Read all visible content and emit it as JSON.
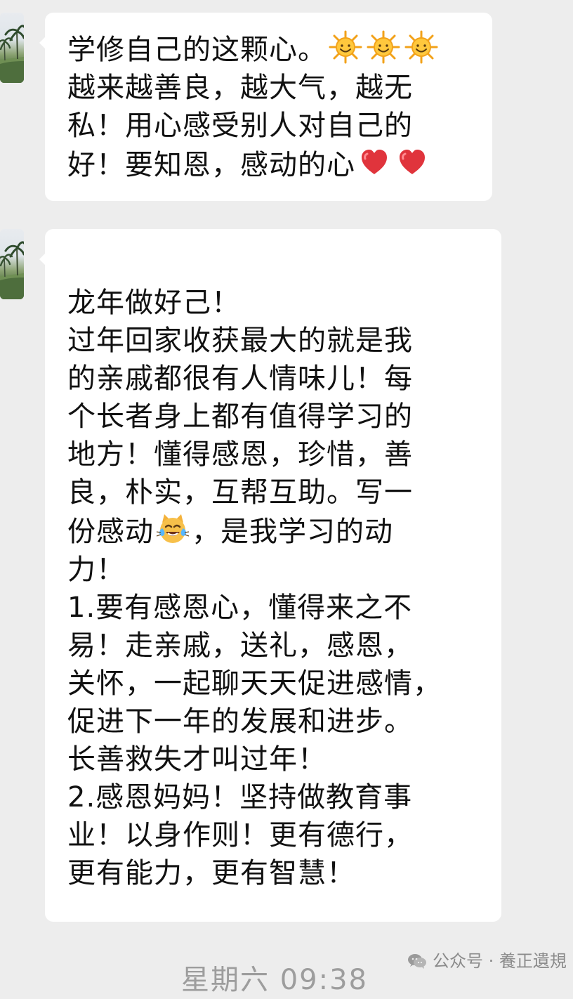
{
  "messages": [
    {
      "lines": [
        {
          "parts": [
            {
              "t": "text",
              "v": "学修自己的这颗心。"
            },
            {
              "t": "icon",
              "v": "sun-emoji"
            },
            {
              "t": "icon",
              "v": "sun-emoji"
            },
            {
              "t": "icon",
              "v": "sun-emoji"
            }
          ]
        },
        {
          "parts": [
            {
              "t": "text",
              "v": "越来越善良，越大气，越无"
            }
          ]
        },
        {
          "parts": [
            {
              "t": "text",
              "v": "私！用心感受别人对自己的"
            }
          ]
        },
        {
          "parts": [
            {
              "t": "text",
              "v": "好！要知恩，感动的心"
            },
            {
              "t": "icon",
              "v": "heart-emoji"
            },
            {
              "t": "icon",
              "v": "heart-emoji"
            }
          ]
        }
      ]
    },
    {
      "lines": [
        {
          "parts": [
            {
              "t": "text",
              "v": "龙年做好己！"
            }
          ]
        },
        {
          "parts": [
            {
              "t": "text",
              "v": "过年回家收获最大的就是我"
            }
          ]
        },
        {
          "parts": [
            {
              "t": "text",
              "v": "的亲戚都很有人情味儿！每"
            }
          ]
        },
        {
          "parts": [
            {
              "t": "text",
              "v": "个长者身上都有值得学习的"
            }
          ]
        },
        {
          "parts": [
            {
              "t": "text",
              "v": "地方！懂得感恩，珍惜，善"
            }
          ]
        },
        {
          "parts": [
            {
              "t": "text",
              "v": "良，朴实，互帮互助。写一"
            }
          ]
        },
        {
          "parts": [
            {
              "t": "text",
              "v": "份感动"
            },
            {
              "t": "icon",
              "v": "cat-tears-of-joy-emoji"
            },
            {
              "t": "text",
              "v": "，是我学习的动"
            }
          ]
        },
        {
          "parts": [
            {
              "t": "text",
              "v": "力！"
            }
          ]
        },
        {
          "parts": [
            {
              "t": "text",
              "v": "1.要有感恩心，懂得来之不"
            }
          ]
        },
        {
          "parts": [
            {
              "t": "text",
              "v": "易！走亲戚，送礼，感恩，"
            }
          ]
        },
        {
          "parts": [
            {
              "t": "text",
              "v": "关怀，一起聊天天促进感情，"
            }
          ]
        },
        {
          "parts": [
            {
              "t": "text",
              "v": "促进下一年的发展和进步。"
            }
          ]
        },
        {
          "parts": [
            {
              "t": "text",
              "v": "长善救失才叫过年！"
            }
          ]
        },
        {
          "parts": [
            {
              "t": "text",
              "v": "2.感恩妈妈！坚持做教育事"
            }
          ]
        },
        {
          "parts": [
            {
              "t": "text",
              "v": "业！以身作则！更有德行，"
            }
          ]
        },
        {
          "parts": [
            {
              "t": "text",
              "v": "更有能力，更有智慧！"
            }
          ]
        }
      ]
    }
  ],
  "timestamp": "星期六 09:38",
  "watermark": {
    "text": "公众号 · 養正遺規",
    "icon": "wechat-icon"
  }
}
